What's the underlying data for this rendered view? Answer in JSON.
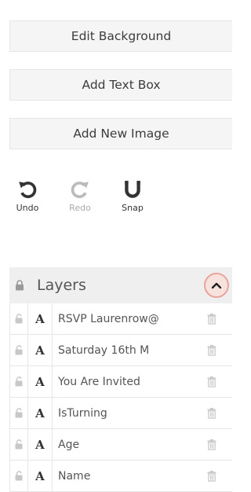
{
  "buttons": {
    "edit_background": "Edit Background",
    "add_text_box": "Add Text Box",
    "add_new_image": "Add New Image"
  },
  "tools": {
    "undo": "Undo",
    "redo": "Redo",
    "snap": "Snap"
  },
  "layers": {
    "title": "Layers",
    "items": [
      {
        "type_icon": "text-icon",
        "type_glyph": "A",
        "label": "RSVP Laurenrow@"
      },
      {
        "type_icon": "text-icon",
        "type_glyph": "A",
        "label": "Saturday 16th M"
      },
      {
        "type_icon": "text-icon",
        "type_glyph": "A",
        "label": "You Are Invited"
      },
      {
        "type_icon": "text-icon",
        "type_glyph": "A",
        "label": "IsTurning"
      },
      {
        "type_icon": "text-icon",
        "type_glyph": "A",
        "label": "Age"
      },
      {
        "type_icon": "text-icon",
        "type_glyph": "A",
        "label": "Name"
      }
    ]
  },
  "colors": {
    "button_bg": "#f5f5f5",
    "header_bg": "#efefef",
    "highlight_ring": "#e8a59c",
    "icon_dark": "#333333",
    "icon_muted": "#bbbbbb"
  }
}
